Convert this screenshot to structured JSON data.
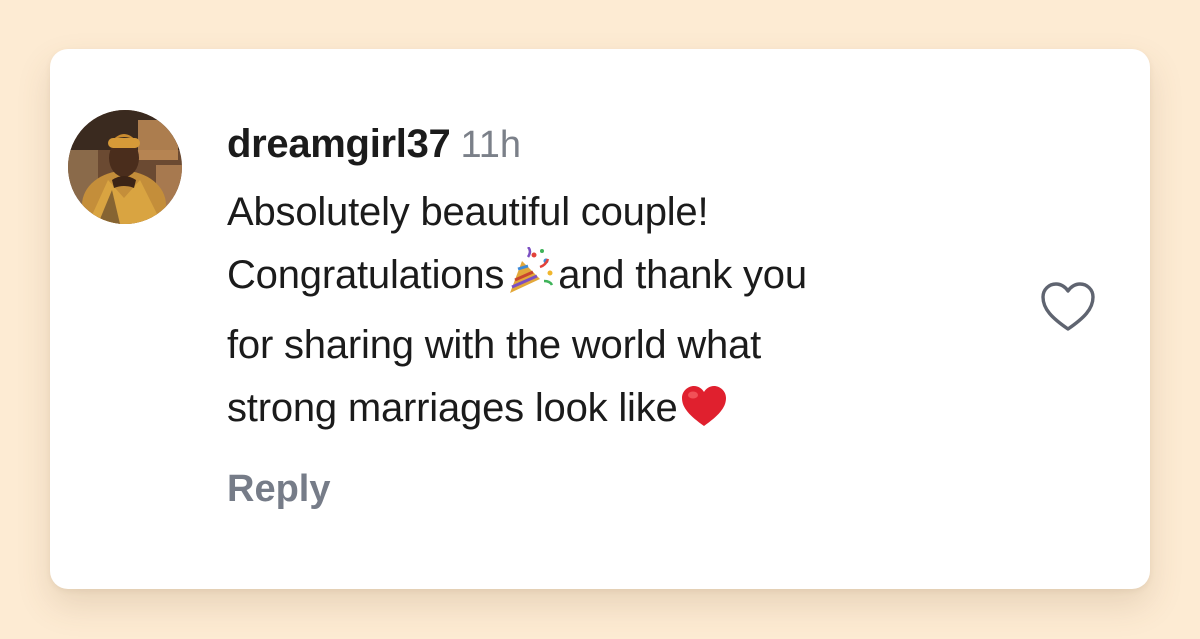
{
  "comment": {
    "username": "dreamgirl37",
    "timestamp": "11h",
    "lines": [
      "Absolutely beautiful couple!",
      "Congratulations",
      "and thank you",
      "for sharing with the world what",
      "strong marriages look like"
    ],
    "reply_label": "Reply",
    "icons": {
      "avatar": "user-avatar-photo",
      "party": "party-popper-icon",
      "heart_emoji": "red-heart-icon",
      "like": "heart-outline-icon"
    }
  },
  "colors": {
    "page_background": "#fdebd3",
    "card_background": "#ffffff",
    "text": "#1b1b1b",
    "muted_text": "#767c88",
    "heart": "#e0202e"
  }
}
